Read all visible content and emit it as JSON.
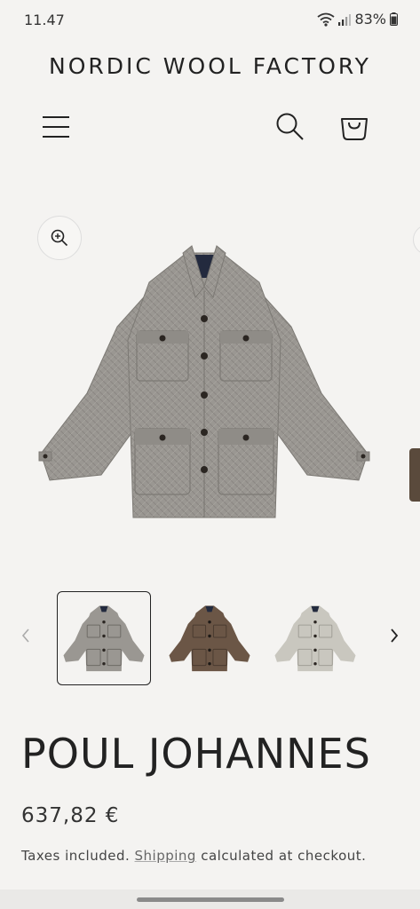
{
  "status_bar": {
    "time": "11.47",
    "battery": "83%"
  },
  "header": {
    "brand": "NORDIC WOOL FACTORY"
  },
  "gallery": {
    "thumbnails": [
      {
        "color": "#9a9792"
      },
      {
        "color": "#6b5646"
      },
      {
        "color": "#c9c7bf"
      }
    ],
    "active_index": 0
  },
  "product": {
    "title": "POUL JOHANNES",
    "price": "637,82 €",
    "tax_prefix": "Taxes included. ",
    "tax_link": "Shipping",
    "tax_suffix": " calculated at checkout."
  },
  "colors": {
    "background": "#f4f3f1",
    "jacket_grey": "#9a9792",
    "collar_navy": "#232a3e",
    "text": "#222222"
  }
}
